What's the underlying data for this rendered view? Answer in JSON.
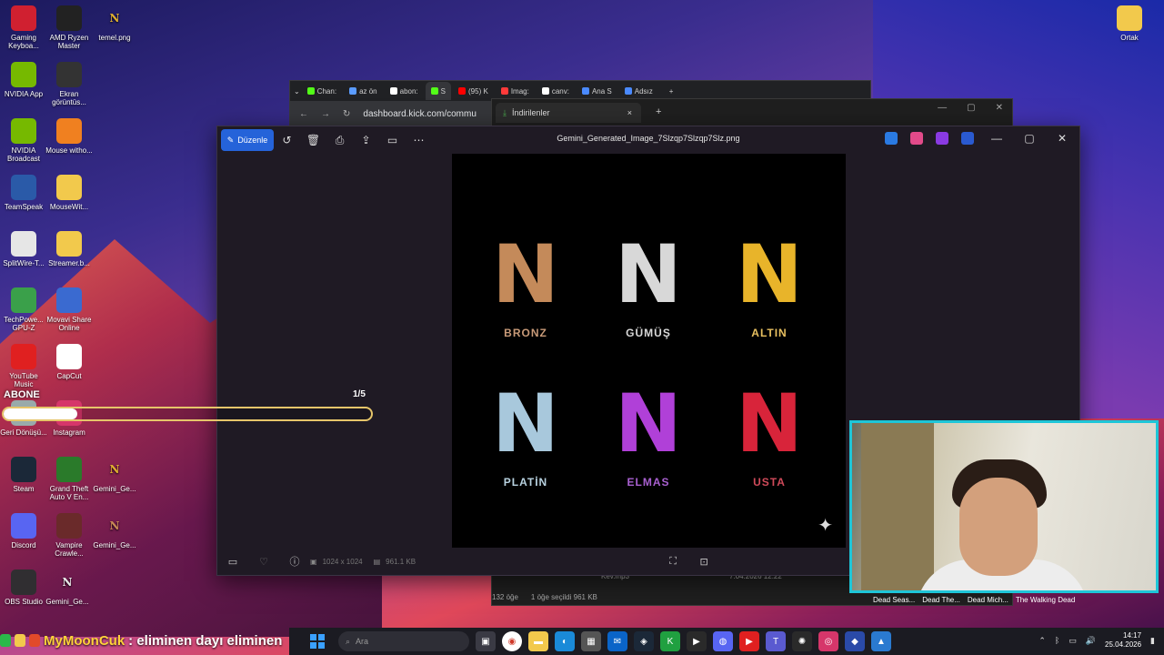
{
  "desktop": {
    "icons_left": [
      {
        "label": "Gaming Keyboa...",
        "icon": "keyboard-icon",
        "color": "#d02030"
      },
      {
        "label": "NVIDIA App",
        "icon": "nvidia-icon",
        "color": "#76b900"
      },
      {
        "label": "NVIDIA Broadcast",
        "icon": "nvidia-broadcast-icon",
        "color": "#76b900"
      },
      {
        "label": "TeamSpeak",
        "icon": "teamspeak-icon",
        "color": "#2a5aa8"
      },
      {
        "label": "SplitWire-T...",
        "icon": "splitwire-icon",
        "color": "#e6e6e6"
      },
      {
        "label": "TechPowe... GPU-Z",
        "icon": "gpuz-icon",
        "color": "#3aa04a"
      },
      {
        "label": "YouTube Music",
        "icon": "youtube-music-icon",
        "color": "#e02020"
      },
      {
        "label": "Geri Dönüşü...",
        "icon": "recycle-bin-icon",
        "color": "#9aa"
      },
      {
        "label": "Steam",
        "icon": "steam-icon",
        "color": "#1b2838"
      },
      {
        "label": "Discord",
        "icon": "discord-icon",
        "color": "#5865f2"
      },
      {
        "label": "OBS Studio",
        "icon": "obs-icon",
        "color": "#302e31"
      }
    ],
    "icons_col2": [
      {
        "label": "AMD Ryzen Master",
        "icon": "ryzen-icon",
        "color": "#222"
      },
      {
        "label": "Ekran görüntüs...",
        "icon": "screenshot-icon",
        "color": "#333"
      },
      {
        "label": "Mouse witho...",
        "icon": "mouse-icon",
        "color": "#f08020"
      },
      {
        "label": "MouseWit...",
        "icon": "folder-icon",
        "color": "#f2c94c"
      },
      {
        "label": "Streamer.b...",
        "icon": "folder-icon",
        "color": "#f2c94c"
      },
      {
        "label": "Movavi Share Online",
        "icon": "movavi-icon",
        "color": "#3a6ad0"
      },
      {
        "label": "CapCut",
        "icon": "capcut-icon",
        "color": "#fff"
      },
      {
        "label": "Instagram",
        "icon": "instagram-icon",
        "color": "#d6366a"
      },
      {
        "label": "Grand Theft Auto V En...",
        "icon": "gta-icon",
        "color": "#2a7a2a"
      },
      {
        "label": "Vampire Crawle...",
        "icon": "vampire-icon",
        "color": "#6a2a2a"
      }
    ],
    "n_icons": [
      {
        "label": "temel.png"
      },
      {
        "label": "Gemini_Ge..."
      },
      {
        "label": "Gemini_Ge..."
      },
      {
        "label": "Gemini_Ge..."
      }
    ],
    "ortak_label": "Ortak"
  },
  "browser": {
    "tabs": [
      "Chan:",
      "az ön",
      "abon:",
      "S",
      "(95) K",
      "Imag:",
      "canv:",
      "Ana S",
      "Adsız"
    ],
    "address": "dashboard.kick.com/commu"
  },
  "downloads": {
    "tab_label": "İndirilenler",
    "file_row": "Kev.mp3",
    "file_date": "7.04.2026 12:22",
    "status_count": "132 öğe",
    "status_selected": "1 öğe seçildi  961 KB"
  },
  "photos": {
    "edit_label": "Düzenle",
    "title": "Gemini_Generated_Image_7Slzqp7Slzqp7Slz.png",
    "dimensions": "1024 x 1024",
    "size": "961.1 KB",
    "tiles": [
      {
        "letter": "N",
        "label": "BRONZ",
        "color": "#c48a5a",
        "label_color": "#c89a78"
      },
      {
        "letter": "N",
        "label": "GÜMÜŞ",
        "color": "#d8d8d8",
        "label_color": "#d8d8d8"
      },
      {
        "letter": "N",
        "label": "ALTIN",
        "color": "#e8b42a",
        "label_color": "#e8c060"
      },
      {
        "letter": "N",
        "label": "PLATİN",
        "color": "#a8c8dc",
        "label_color": "#b8d2e0"
      },
      {
        "letter": "N",
        "label": "ELMAS",
        "color": "#b040d8",
        "label_color": "#a860d0"
      },
      {
        "letter": "N",
        "label": "USTA",
        "color": "#d8243a",
        "label_color": "#d04a5a"
      }
    ]
  },
  "overlay": {
    "abone_label": "ABONE",
    "progress_count": "1/5",
    "progress_fraction": 0.2
  },
  "chat": {
    "username": "MyMoonCuk",
    "message": ": eliminen dayı eliminen"
  },
  "dock_labels": [
    "Dead Seas...",
    "Dead The...",
    "Dead Mich...",
    "The Walking Dead"
  ],
  "taskbar": {
    "search_placeholder": "Ara",
    "time": "14:17",
    "date": "25.04.2026"
  }
}
